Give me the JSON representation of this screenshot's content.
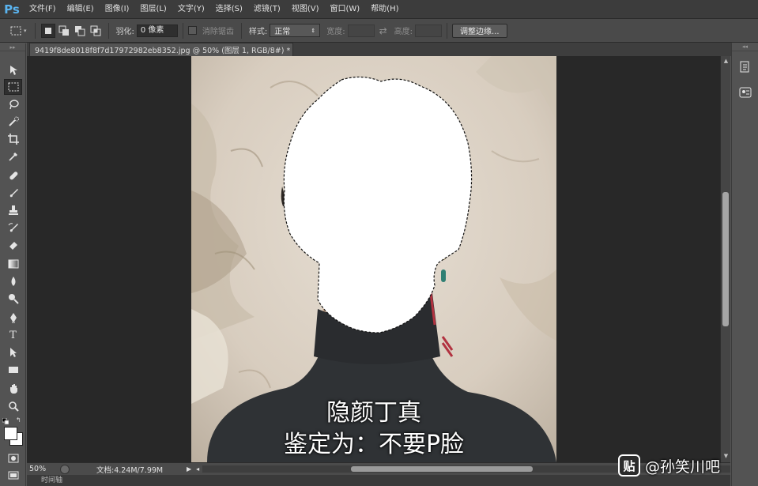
{
  "app": {
    "logo": "Ps",
    "menu": [
      "文件(F)",
      "编辑(E)",
      "图像(I)",
      "图层(L)",
      "文字(Y)",
      "选择(S)",
      "滤镜(T)",
      "视图(V)",
      "窗口(W)",
      "帮助(H)"
    ]
  },
  "options": {
    "feather_label": "羽化:",
    "feather_value": "0 像素",
    "antialias_label": "消除锯齿",
    "style_label": "样式:",
    "style_value": "正常",
    "width_label": "宽度:",
    "height_label": "高度:",
    "refine_edge_button": "调整边缘..."
  },
  "document": {
    "tab_title": "9419f8de8018f8f7d17972982eb8352.jpg @ 50% (图层 1, RGB/8#) *",
    "tab_close": "×"
  },
  "image_text": {
    "line1": "隐颜丁真",
    "line2": "鉴定为：不要P脸"
  },
  "status": {
    "zoom": "50%",
    "doc_info": "文档:4.24M/7.99M"
  },
  "timeline": {
    "label": "时间轴"
  },
  "watermark": {
    "logo": "贴",
    "text": "@孙笑川吧"
  },
  "colors": {
    "foreground": "#ffffff",
    "background": "#ffffff",
    "ps_logo": "#5ab4f0"
  },
  "tools": [
    "move-tool-icon",
    "marquee-tool-icon",
    "lasso-tool-icon",
    "quick-selection-tool-icon",
    "crop-tool-icon",
    "eyedropper-tool-icon",
    "spot-healing-tool-icon",
    "brush-tool-icon",
    "clone-stamp-tool-icon",
    "history-brush-tool-icon",
    "eraser-tool-icon",
    "gradient-tool-icon",
    "blur-tool-icon",
    "dodge-tool-icon",
    "pen-tool-icon",
    "type-tool-icon",
    "path-selection-tool-icon",
    "rectangle-tool-icon",
    "hand-tool-icon",
    "zoom-tool-icon"
  ]
}
